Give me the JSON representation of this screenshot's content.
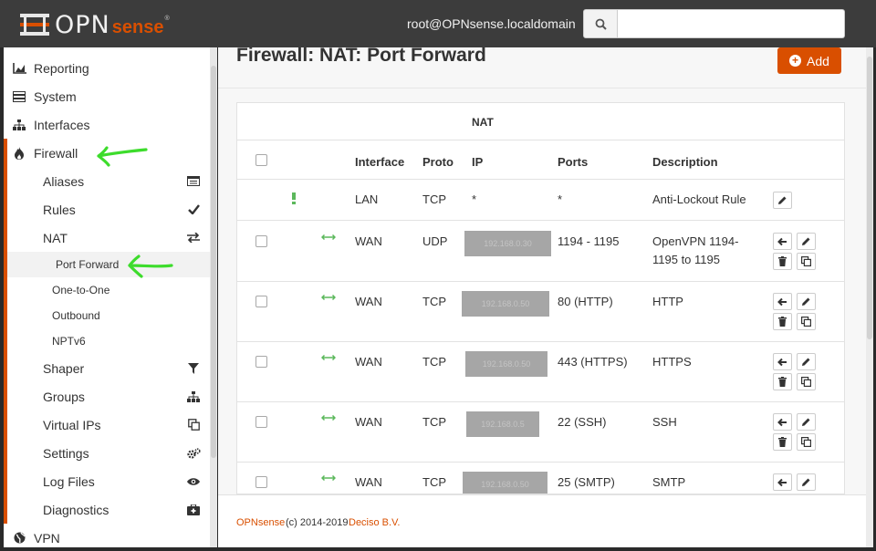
{
  "header": {
    "logo_opn": "OPN",
    "logo_sense": "sense",
    "logo_reg": "®",
    "user": "root@OPNsense.localdomain",
    "search_value": ""
  },
  "sidebar": {
    "top_items": [
      {
        "label": "Reporting",
        "icon": "chart-area-icon"
      },
      {
        "label": "System",
        "icon": "server-icon"
      },
      {
        "label": "Interfaces",
        "icon": "sitemap-icon"
      },
      {
        "label": "Firewall",
        "icon": "fire-icon"
      }
    ],
    "firewall_items": [
      {
        "label": "Aliases",
        "icon": "list-icon"
      },
      {
        "label": "Rules",
        "icon": "check-icon"
      },
      {
        "label": "NAT",
        "icon": "exchange-icon"
      }
    ],
    "nat_items": [
      "Port Forward",
      "One-to-One",
      "Outbound",
      "NPTv6"
    ],
    "more_items": [
      {
        "label": "Shaper",
        "icon": "filter-icon"
      },
      {
        "label": "Groups",
        "icon": "sitemap-icon"
      },
      {
        "label": "Virtual IPs",
        "icon": "clone-icon"
      },
      {
        "label": "Settings",
        "icon": "cogs-icon"
      },
      {
        "label": "Log Files",
        "icon": "eye-icon"
      },
      {
        "label": "Diagnostics",
        "icon": "medkit-icon"
      }
    ],
    "vpn": {
      "label": "VPN",
      "icon": "globe-icon"
    }
  },
  "page": {
    "title": "Firewall: NAT: Port Forward",
    "add_label": "Add"
  },
  "table": {
    "group_header": "NAT",
    "columns": [
      "Interface",
      "Proto",
      "IP",
      "Ports",
      "Description"
    ],
    "rows": [
      {
        "interface": "LAN",
        "proto": "TCP",
        "ip": "*",
        "ports": "*",
        "description": "Anti-Lockout Rule",
        "icon": "exclamation-icon"
      },
      {
        "interface": "WAN",
        "proto": "UDP",
        "ip": "192.168.0.30",
        "ports": "1194 - 1195",
        "description_line1": "OpenVPN 1194-",
        "description_line2": "1195 to 1195",
        "icon": "arrows-h-icon"
      },
      {
        "interface": "WAN",
        "proto": "TCP",
        "ip": "192.168.0.50",
        "ports": "80 (HTTP)",
        "description": "HTTP",
        "icon": "arrows-h-icon"
      },
      {
        "interface": "WAN",
        "proto": "TCP",
        "ip": "192.168.0.50",
        "ports": "443 (HTTPS)",
        "description": "HTTPS",
        "icon": "arrows-h-icon"
      },
      {
        "interface": "WAN",
        "proto": "TCP",
        "ip": "192.168.0.5",
        "ports": "22 (SSH)",
        "description": "SSH",
        "icon": "arrows-h-icon"
      },
      {
        "interface": "WAN",
        "proto": "TCP",
        "ip": "192.168.0.50",
        "ports": "25 (SMTP)",
        "description": "SMTP",
        "icon": "arrows-h-icon"
      }
    ]
  },
  "footer": {
    "brand": "OPNsense",
    "copyright": "(c) 2014-2019",
    "company": "Deciso B.V."
  },
  "colors": {
    "accent": "#d94f00",
    "annotation": "#3ddc2c",
    "navbar": "#3c3c3c"
  }
}
